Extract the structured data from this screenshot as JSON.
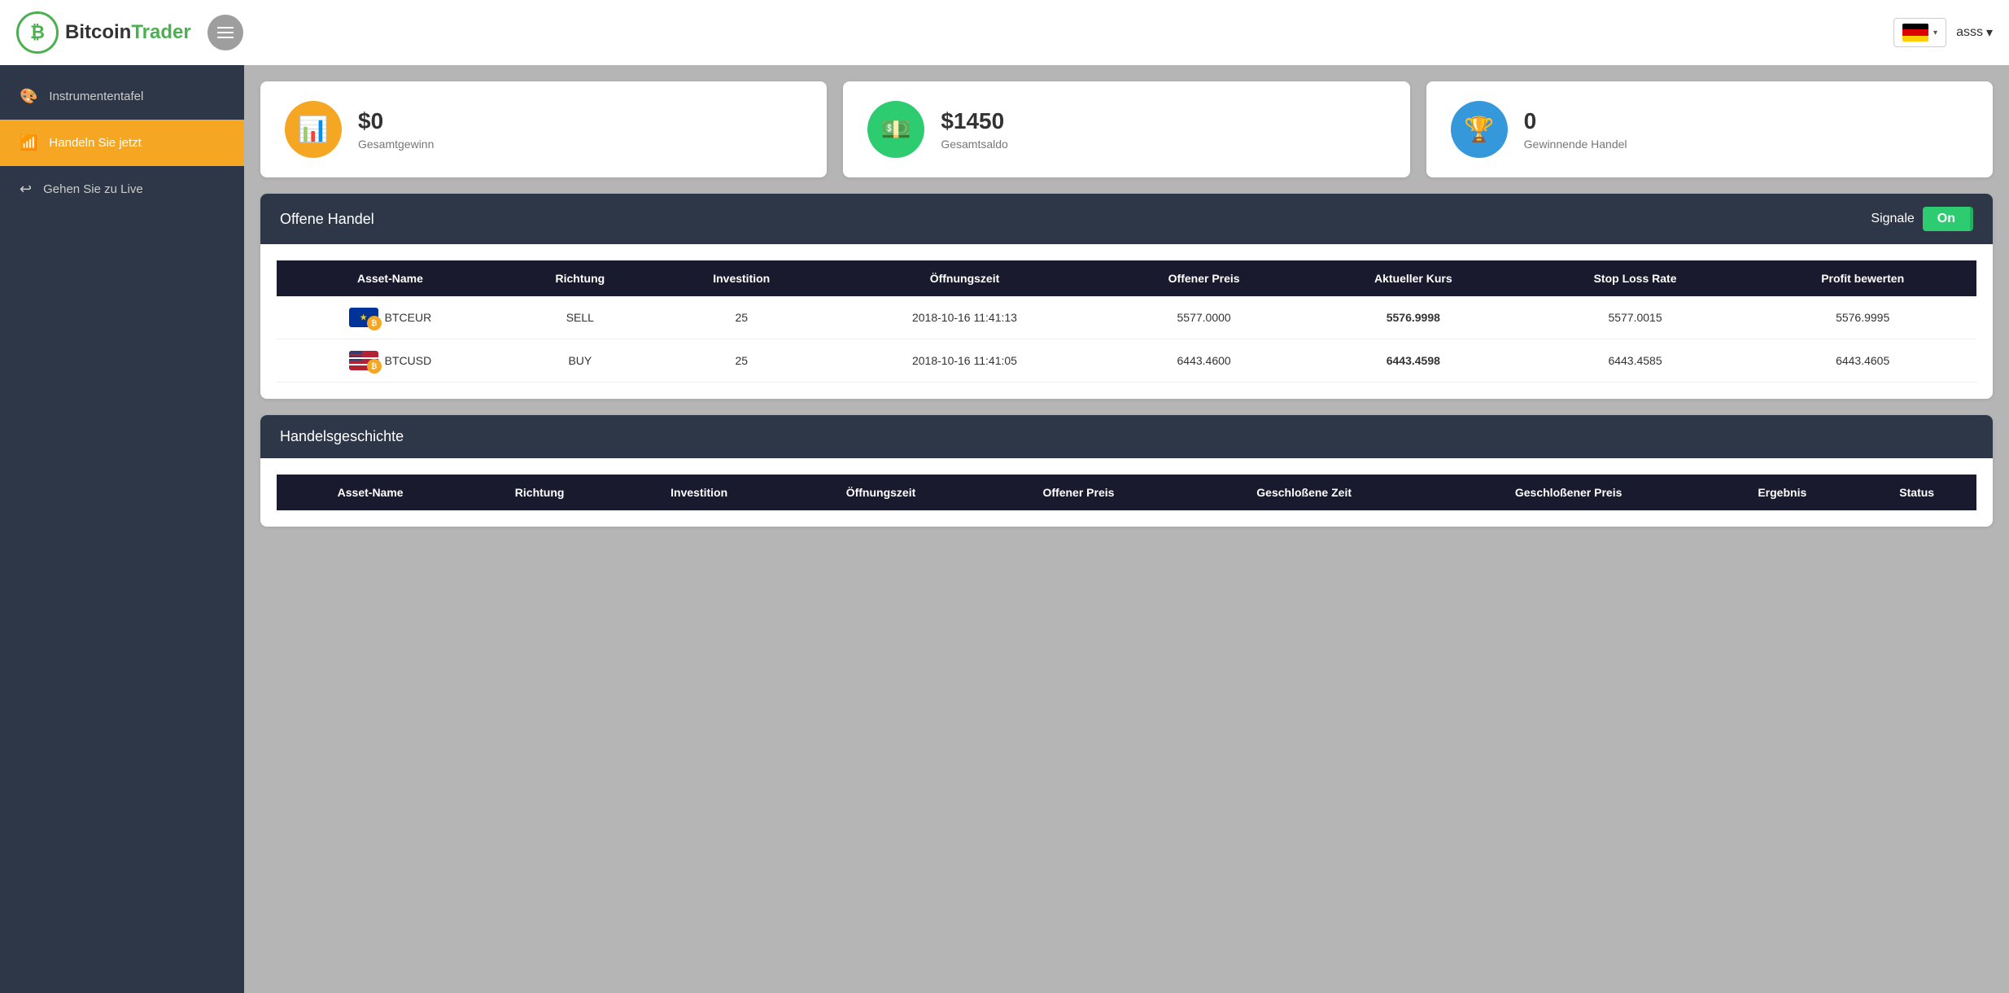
{
  "header": {
    "logo_bitcoin": "Bitcoin",
    "logo_trader": "Trader",
    "logo_symbol": "₿",
    "lang": "DE",
    "user": "asss",
    "chevron": "▾"
  },
  "sidebar": {
    "items": [
      {
        "id": "instrumententafel",
        "label": "Instrumententafel",
        "icon": "🎨",
        "active": false
      },
      {
        "id": "handeln",
        "label": "Handeln Sie jetzt",
        "icon": "📶",
        "active": true
      },
      {
        "id": "live",
        "label": "Gehen Sie zu Live",
        "icon": "↩",
        "active": false
      }
    ]
  },
  "stats": [
    {
      "id": "gesamtgewinn",
      "value": "$0",
      "label": "Gesamtgewinn",
      "icon": "📊",
      "color": "yellow"
    },
    {
      "id": "gesamtsaldo",
      "value": "$1450",
      "label": "Gesamtsaldo",
      "icon": "💵",
      "color": "green"
    },
    {
      "id": "gewinnende",
      "value": "0",
      "label": "Gewinnende Handel",
      "icon": "🏆",
      "color": "blue"
    }
  ],
  "open_trades": {
    "title": "Offene Handel",
    "signals_label": "Signale",
    "signals_state": "On",
    "columns": [
      "Asset-Name",
      "Richtung",
      "Investition",
      "Öffnungszeit",
      "Offener Preis",
      "Aktueller Kurs",
      "Stop Loss Rate",
      "Profit bewerten"
    ],
    "rows": [
      {
        "asset": "BTCEUR",
        "flag": "eu",
        "direction": "SELL",
        "investment": "25",
        "open_time": "2018-10-16 11:41:13",
        "open_price": "5577.0000",
        "current_rate": "5576.9998",
        "stop_loss": "5577.0015",
        "profit": "5576.9995"
      },
      {
        "asset": "BTCUSD",
        "flag": "us",
        "direction": "BUY",
        "investment": "25",
        "open_time": "2018-10-16 11:41:05",
        "open_price": "6443.4600",
        "current_rate": "6443.4598",
        "stop_loss": "6443.4585",
        "profit": "6443.4605"
      }
    ]
  },
  "trade_history": {
    "title": "Handelsgeschichte",
    "columns": [
      "Asset-Name",
      "Richtung",
      "Investition",
      "Öffnungszeit",
      "Offener Preis",
      "Geschloßene Zeit",
      "Geschloßener Preis",
      "Ergebnis",
      "Status"
    ],
    "rows": []
  }
}
